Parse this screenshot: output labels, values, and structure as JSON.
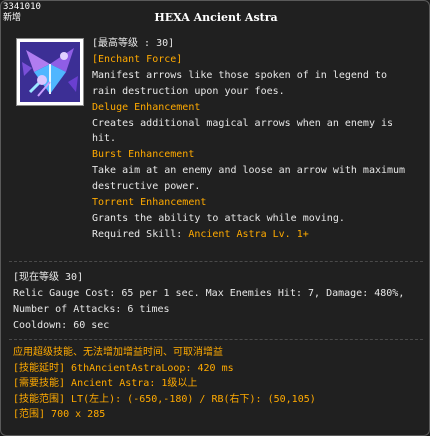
{
  "header": {
    "id": "3341010",
    "new_label": "新增",
    "title": "HEXA Ancient Astra"
  },
  "icon": {
    "name": "ancient-astra-skill-icon"
  },
  "description": {
    "max_level": "[最高等级 : 30]",
    "enchant_force": "[Enchant Force]",
    "desc_line1": "Manifest arrows like those spoken of in legend to",
    "desc_line2": "rain destruction upon your foes.",
    "deluge_title": "Deluge Enhancement",
    "deluge_line1": "Creates additional magical arrows when an enemy is",
    "deluge_line2": "hit.",
    "burst_title": "Burst Enhancement",
    "burst_line1": "Take aim at an enemy and loose an arrow with maximum",
    "burst_line2": "destructive power.",
    "torrent_title": "Torrent Enhancement",
    "torrent_line1": "Grants the ability to attack while moving.",
    "required_label": "Required Skill: ",
    "required_value": "Ancient Astra Lv. 1+"
  },
  "current": {
    "level": "[现在等级 30]",
    "line1": "Relic Gauge Cost: 65 per 1 sec. Max Enemies Hit: 7, Damage: 480%,",
    "line2": "Number of Attacks: 6 times",
    "line3": "Cooldown: 60 sec"
  },
  "extra": {
    "line1": "应用超级技能、无法增加增益时间、可取消增益",
    "line2": "[技能延时] 6thAncientAstraLoop: 420 ms",
    "line3": "[需要技能] Ancient Astra: 1级以上",
    "line4": "[技能范围] LT(左上): (-650,-180) / RB(右下): (50,105)",
    "line5": "[范围] 700 x 285"
  },
  "colors": {
    "accent": "#ffaa00",
    "text": "#e8e8e8",
    "background": "#202020"
  }
}
